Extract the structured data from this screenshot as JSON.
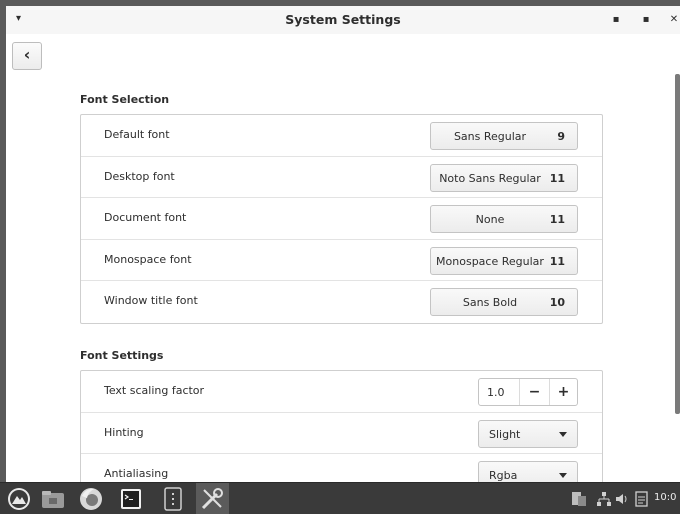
{
  "window": {
    "title": "System Settings",
    "minimize_icon": "minimize-icon",
    "maximize_icon": "maximize-icon",
    "close_icon": "close-icon",
    "back_icon": "chevron-left-icon",
    "back_glyph": "‹"
  },
  "font_selection": {
    "heading": "Font Selection",
    "rows": [
      {
        "label": "Default font",
        "font": "Sans Regular",
        "size": "9"
      },
      {
        "label": "Desktop font",
        "font": "Noto Sans Regular",
        "size": "11"
      },
      {
        "label": "Document font",
        "font": "None",
        "size": "11"
      },
      {
        "label": "Monospace font",
        "font": "Monospace Regular",
        "size": "11"
      },
      {
        "label": "Window title font",
        "font": "Sans Bold",
        "size": "10"
      }
    ]
  },
  "font_settings": {
    "heading": "Font Settings",
    "text_scaling": {
      "label": "Text scaling factor",
      "value": "1.0",
      "minus": "−",
      "plus": "+"
    },
    "hinting": {
      "label": "Hinting",
      "value": "Slight"
    },
    "antialiasing": {
      "label": "Antialiasing",
      "value": "Rgba"
    }
  },
  "taskbar": {
    "icons": [
      "menu-icon",
      "file-manager-icon",
      "firefox-icon",
      "terminal-icon",
      "text-editor-icon",
      "system-settings-icon"
    ],
    "tray_icons": [
      "clipboard-icon",
      "network-icon",
      "volume-icon",
      "notes-icon"
    ],
    "clock": "10:0"
  }
}
